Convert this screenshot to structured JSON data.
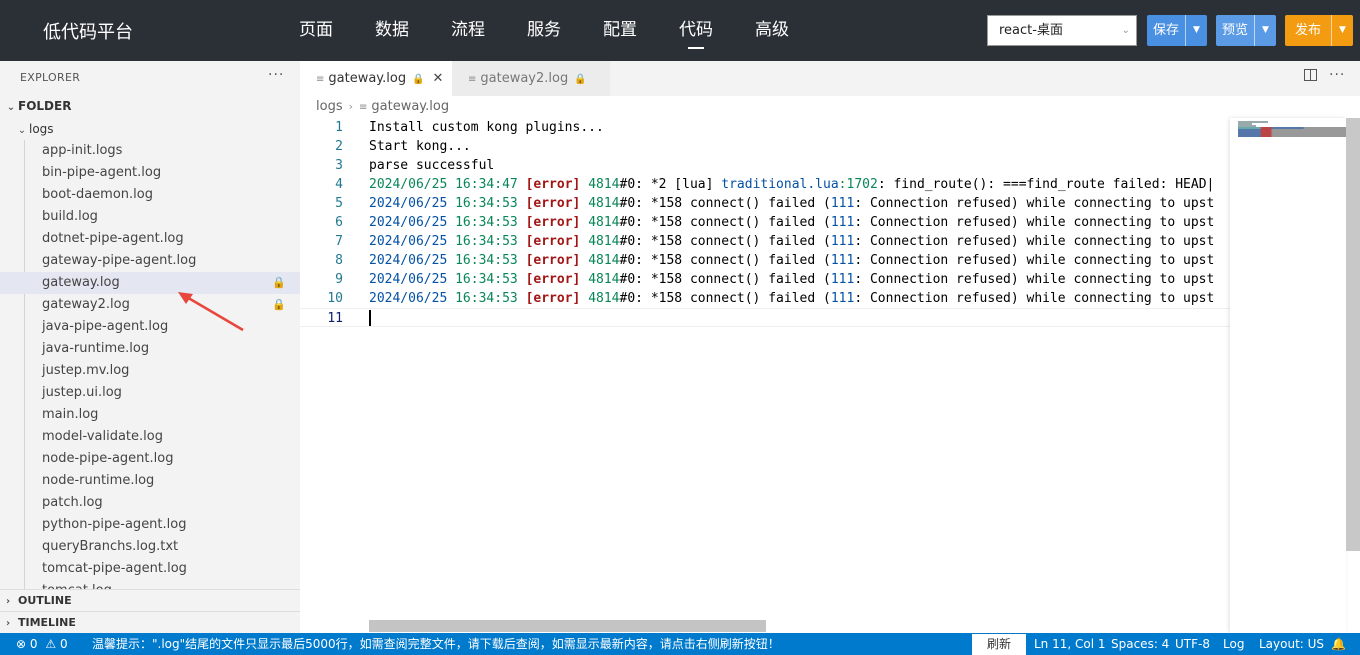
{
  "header": {
    "brand": "低代码平台",
    "nav": [
      {
        "label": "页面"
      },
      {
        "label": "数据"
      },
      {
        "label": "流程"
      },
      {
        "label": "服务"
      },
      {
        "label": "配置"
      },
      {
        "label": "代码",
        "active": true
      },
      {
        "label": "高级"
      }
    ],
    "env_select": "react-桌面",
    "save_label": "保存",
    "preview_label": "预览",
    "publish_label": "发布"
  },
  "explorer": {
    "title": "EXPLORER",
    "root_folder": "FOLDER",
    "subfolder": "logs",
    "files": [
      {
        "name": "app-init.logs"
      },
      {
        "name": "bin-pipe-agent.log"
      },
      {
        "name": "boot-daemon.log"
      },
      {
        "name": "build.log"
      },
      {
        "name": "dotnet-pipe-agent.log"
      },
      {
        "name": "gateway-pipe-agent.log"
      },
      {
        "name": "gateway.log",
        "selected": true,
        "locked": true
      },
      {
        "name": "gateway2.log",
        "locked": true
      },
      {
        "name": "java-pipe-agent.log"
      },
      {
        "name": "java-runtime.log"
      },
      {
        "name": "justep.mv.log"
      },
      {
        "name": "justep.ui.log"
      },
      {
        "name": "main.log"
      },
      {
        "name": "model-validate.log"
      },
      {
        "name": "node-pipe-agent.log"
      },
      {
        "name": "node-runtime.log"
      },
      {
        "name": "patch.log"
      },
      {
        "name": "python-pipe-agent.log"
      },
      {
        "name": "queryBranchs.log.txt"
      },
      {
        "name": "tomcat-pipe-agent.log"
      },
      {
        "name": "tomcat.log"
      }
    ],
    "outline_label": "OUTLINE",
    "timeline_label": "TIMELINE"
  },
  "editor": {
    "tabs": [
      {
        "label": "gateway.log",
        "active": true
      },
      {
        "label": "gateway2.log",
        "active": false
      }
    ],
    "breadcrumb": [
      "logs",
      "gateway.log"
    ],
    "lines": [
      {
        "n": "1",
        "text": "Install custom kong plugins..."
      },
      {
        "n": "2",
        "text": "Start kong..."
      },
      {
        "n": "3",
        "text": "parse successful"
      },
      {
        "n": "4",
        "date": "2024/06/25",
        "time": "16:34:47",
        "level": "[error]",
        "pid": "4814",
        "conn": "#0: ",
        "rest": "*2 [lua] ",
        "file": "traditional.lua",
        "line": ":1702",
        "msg": ": find_route(): ===find_route failed: HEAD|"
      },
      {
        "n": "5",
        "date": "2024/06/25",
        "time": "16:34:53",
        "level": "[error]",
        "pid": "4814",
        "conn": "#0: ",
        "rest": "*158 connect() failed (",
        "code": "111",
        "msg": ": Connection refused) while connecting to upst"
      },
      {
        "n": "6",
        "date": "2024/06/25",
        "time": "16:34:53",
        "level": "[error]",
        "pid": "4814",
        "conn": "#0: ",
        "rest": "*158 connect() failed (",
        "code": "111",
        "msg": ": Connection refused) while connecting to upst"
      },
      {
        "n": "7",
        "date": "2024/06/25",
        "time": "16:34:53",
        "level": "[error]",
        "pid": "4814",
        "conn": "#0: ",
        "rest": "*158 connect() failed (",
        "code": "111",
        "msg": ": Connection refused) while connecting to upst"
      },
      {
        "n": "8",
        "date": "2024/06/25",
        "time": "16:34:53",
        "level": "[error]",
        "pid": "4814",
        "conn": "#0: ",
        "rest": "*158 connect() failed (",
        "code": "111",
        "msg": ": Connection refused) while connecting to upst"
      },
      {
        "n": "9",
        "date": "2024/06/25",
        "time": "16:34:53",
        "level": "[error]",
        "pid": "4814",
        "conn": "#0: ",
        "rest": "*158 connect() failed (",
        "code": "111",
        "msg": ": Connection refused) while connecting to upst"
      },
      {
        "n": "10",
        "date": "2024/06/25",
        "time": "16:34:53",
        "level": "[error]",
        "pid": "4814",
        "conn": "#0: ",
        "rest": "*158 connect() failed (",
        "code": "111",
        "msg": ": Connection refused) while connecting to upst"
      },
      {
        "n": "11",
        "text": "",
        "current": true
      }
    ]
  },
  "status": {
    "errors": "0",
    "warnings": "0",
    "notice": "温馨提示：\".log\"结尾的文件只显示最后5000行，如需查阅完整文件，请下载后查阅，如需显示最新内容，请点击右侧刷新按钮！",
    "refresh_label": "刷新",
    "cursor_pos": "Ln 11, Col 1",
    "spaces": "Spaces: 4",
    "encoding": "UTF-8",
    "language": "Log",
    "layout": "Layout: US"
  },
  "colors": {
    "topbar": "#2b3037",
    "statusbar": "#007acc",
    "save": "#4a90e2",
    "preview": "#5b9be6",
    "publish": "#f39c12",
    "error_level": "#a31515",
    "date": "#098658",
    "number": "#0451a5",
    "annotation_arrow": "#e8453c"
  },
  "icons": [
    "file-lines-icon",
    "lock-icon",
    "close-icon",
    "chevron-down-icon",
    "chevron-right-icon",
    "split-editor-icon",
    "more-icon",
    "error-icon",
    "warning-icon",
    "bell-icon",
    "red-arrow-annotation"
  ]
}
